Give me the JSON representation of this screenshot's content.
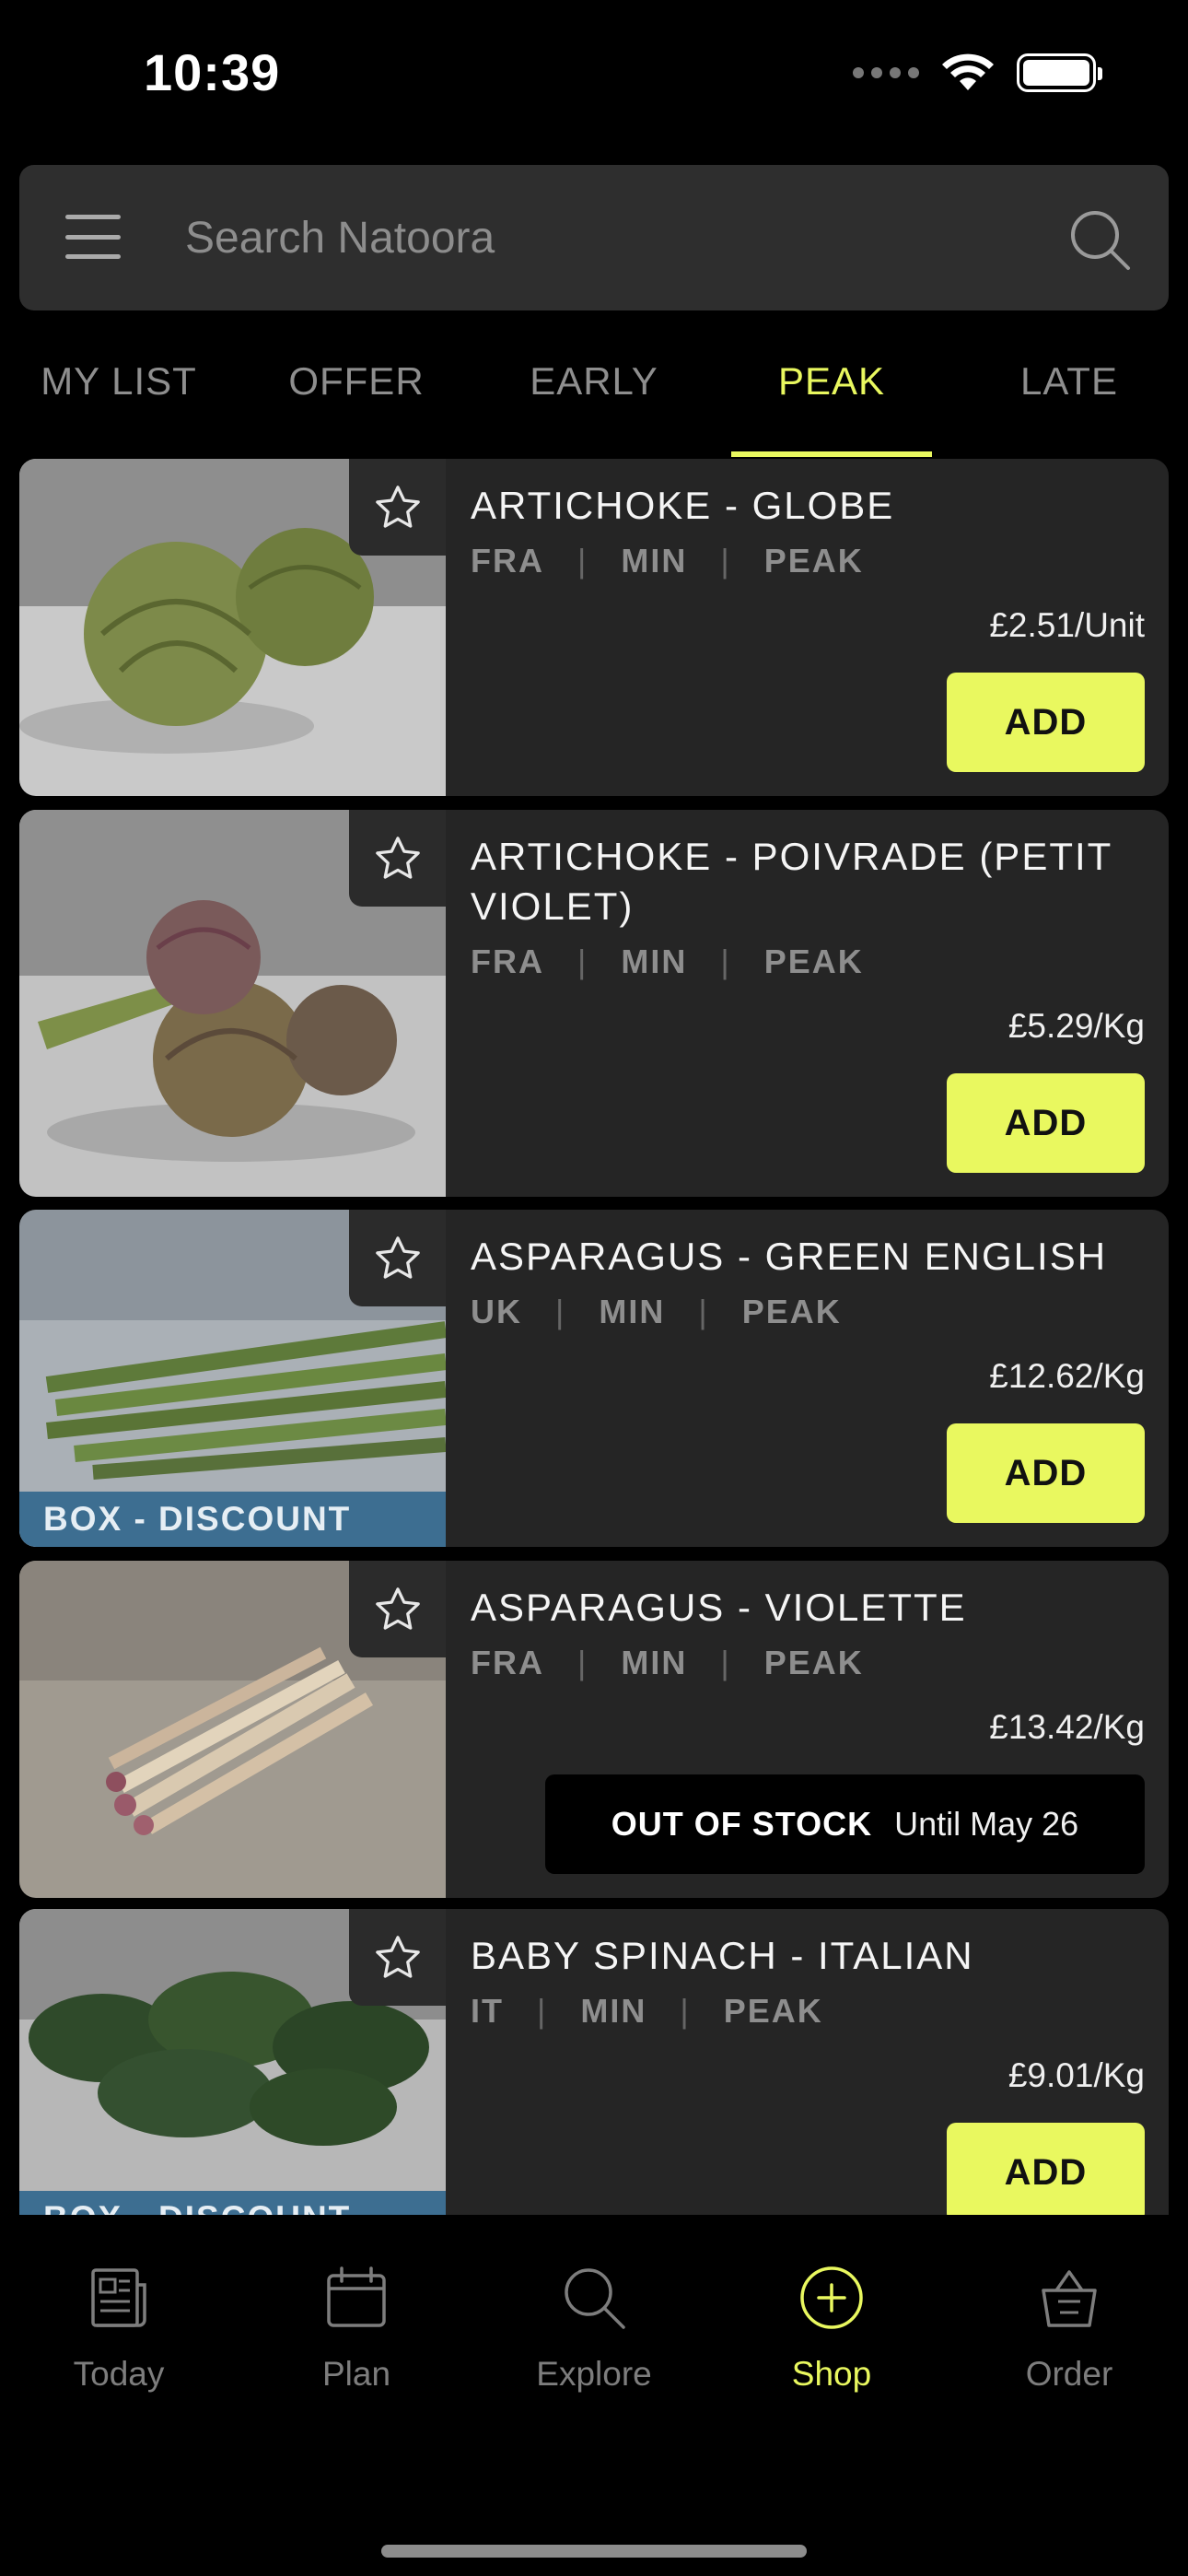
{
  "status_bar": {
    "time": "10:39"
  },
  "search": {
    "placeholder": "Search Natoora"
  },
  "tabs": [
    {
      "label": "MY LIST",
      "active": false
    },
    {
      "label": "OFFER",
      "active": false
    },
    {
      "label": "EARLY",
      "active": false
    },
    {
      "label": "PEAK",
      "active": true
    },
    {
      "label": "LATE",
      "active": false
    }
  ],
  "products": [
    {
      "name": "ARTICHOKE - GLOBE",
      "origin": "FRA",
      "unit": "MIN",
      "season": "PEAK",
      "price": "£2.51/Unit",
      "action": "ADD",
      "badge": ""
    },
    {
      "name": "ARTICHOKE - POIVRADE (PETIT VIOLET)",
      "origin": "FRA",
      "unit": "MIN",
      "season": "PEAK",
      "price": "£5.29/Kg",
      "action": "ADD",
      "badge": ""
    },
    {
      "name": "ASPARAGUS - GREEN ENGLISH",
      "origin": "UK",
      "unit": "MIN",
      "season": "PEAK",
      "price": "£12.62/Kg",
      "action": "ADD",
      "badge": "BOX - DISCOUNT"
    },
    {
      "name": "ASPARAGUS - VIOLETTE",
      "origin": "FRA",
      "unit": "MIN",
      "season": "PEAK",
      "price": "£13.42/Kg",
      "out_of_stock": "OUT OF STOCK",
      "until": "Until May 26",
      "badge": ""
    },
    {
      "name": "BABY SPINACH - ITALIAN",
      "origin": "IT",
      "unit": "MIN",
      "season": "PEAK",
      "price": "£9.01/Kg",
      "action": "ADD",
      "badge": "BOX - DISCOUNT"
    }
  ],
  "nav": [
    {
      "label": "Today",
      "icon": "newspaper-icon",
      "active": false
    },
    {
      "label": "Plan",
      "icon": "calendar-icon",
      "active": false
    },
    {
      "label": "Explore",
      "icon": "search-icon",
      "active": false
    },
    {
      "label": "Shop",
      "icon": "plus-circle-icon",
      "active": true
    },
    {
      "label": "Order",
      "icon": "basket-icon",
      "active": false
    }
  ],
  "colors": {
    "accent": "#e9f85f",
    "card": "#252525",
    "badge": "#3d6e91",
    "background": "#000000"
  }
}
